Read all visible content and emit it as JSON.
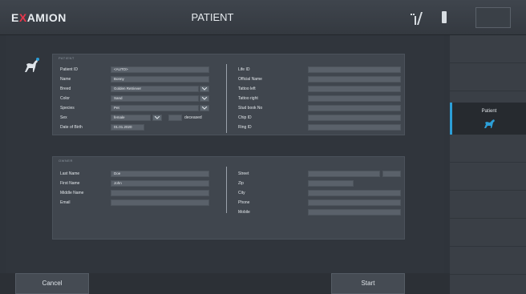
{
  "header": {
    "logo_prefix": "E",
    "logo_x": "X",
    "logo_suffix": "AMION",
    "title": "PATIENT"
  },
  "sidebar": {
    "active_label": "Patient"
  },
  "patient": {
    "section_title": "PATIENT",
    "left_fields": [
      {
        "label": "Patient ID",
        "value": "<AUTO>"
      },
      {
        "label": "Name",
        "value": "Bonny"
      },
      {
        "label": "Breed",
        "value": "Golden Retriever"
      },
      {
        "label": "Color",
        "value": "Sand"
      },
      {
        "label": "Species",
        "value": "Pet"
      },
      {
        "label": "Sex",
        "value": "female"
      },
      {
        "label": "Date of Birth",
        "value": "01.01.2020"
      }
    ],
    "deceased_label": "deceased",
    "right_fields": [
      {
        "label": "Life ID",
        "value": ""
      },
      {
        "label": "Official Name",
        "value": ""
      },
      {
        "label": "Tattoo left",
        "value": ""
      },
      {
        "label": "Tattoo right",
        "value": ""
      },
      {
        "label": "Stud book No",
        "value": ""
      },
      {
        "label": "Chip ID",
        "value": ""
      },
      {
        "label": "Ring ID",
        "value": ""
      }
    ]
  },
  "owner": {
    "section_title": "OWNER",
    "left_fields": [
      {
        "label": "Last Name",
        "value": "Doe"
      },
      {
        "label": "First Name",
        "value": "John"
      },
      {
        "label": "Middle Name",
        "value": ""
      },
      {
        "label": "Email",
        "value": ""
      }
    ],
    "right_fields": [
      {
        "label": "Street",
        "value": ""
      },
      {
        "label": "Zip",
        "value": ""
      },
      {
        "label": "City",
        "value": ""
      },
      {
        "label": "Phone",
        "value": ""
      },
      {
        "label": "Mobile",
        "value": ""
      }
    ]
  },
  "buttons": {
    "cancel": "Cancel",
    "start": "Start"
  },
  "colors": {
    "accent": "#2c9fd8",
    "logo_x": "#e8364b",
    "background": "#2f343b"
  },
  "icons": [
    "dog-icon",
    "antenna-icon",
    "battery-icon"
  ]
}
